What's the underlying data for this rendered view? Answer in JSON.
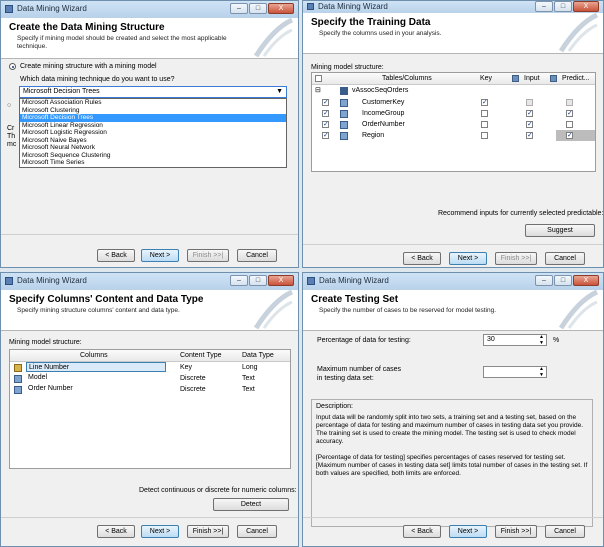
{
  "app_title": "Data Mining Wizard",
  "nav": {
    "back": "< Back",
    "next": "Next >",
    "finish": "Finish >>|",
    "cancel": "Cancel"
  },
  "win_controls": {
    "min": "–",
    "max": "□",
    "close": "X"
  },
  "w1": {
    "title": "Create the Data Mining Structure",
    "subtitle": "Specify if mining model should be created and select the most applicable technique.",
    "radio_label": "Create mining structure with a mining model",
    "question": "Which data mining technique do you want to use?",
    "selected": "Microsoft Decision Trees",
    "options": [
      "Microsoft Association Rules",
      "Microsoft Clustering",
      "Microsoft Decision Trees",
      "Microsoft Linear Regression",
      "Microsoft Logistic Regression",
      "Microsoft Naive Bayes",
      "Microsoft Neural Network",
      "Microsoft Sequence Clustering",
      "Microsoft Time Series"
    ],
    "left_glimpse": [
      "Cr",
      "Th",
      "mc"
    ]
  },
  "w2": {
    "title": "Specify the Training Data",
    "subtitle": "Specify the columns used in your analysis.",
    "structure_label": "Mining model structure:",
    "cols": {
      "tables": "Tables/Columns",
      "key": "Key",
      "input": "Input",
      "predict": "Predict..."
    },
    "table_name": "vAssocSeqOrders",
    "rows": [
      {
        "name": "CustomerKey",
        "key": true,
        "input": false,
        "predict": false
      },
      {
        "name": "IncomeGroup",
        "key": false,
        "input": true,
        "predict": true
      },
      {
        "name": "OrderNumber",
        "key": false,
        "input": true,
        "predict": false
      },
      {
        "name": "Region",
        "key": false,
        "input": true,
        "predict": true
      }
    ],
    "recommend": "Recommend inputs for currently selected predictable:",
    "suggest": "Suggest"
  },
  "w3": {
    "title": "Specify Columns' Content and Data Type",
    "subtitle": "Specify mining structure columns' content and data type.",
    "structure_label": "Mining model structure:",
    "cols": {
      "columns": "Columns",
      "content": "Content Type",
      "dtype": "Data Type"
    },
    "rows": [
      {
        "name": "Line Number",
        "content": "Key",
        "dtype": "Long"
      },
      {
        "name": "Model",
        "content": "Discrete",
        "dtype": "Text"
      },
      {
        "name": "Order Number",
        "content": "Discrete",
        "dtype": "Text"
      }
    ],
    "detect_label": "Detect continuous or discrete for numeric columns:",
    "detect": "Detect"
  },
  "w4": {
    "title": "Create Testing Set",
    "subtitle": "Specify the number of cases to be reserved for model testing.",
    "pct_label": "Percentage of data for testing:",
    "pct_value": "30",
    "pct_unit": "%",
    "max_label1": "Maximum number of cases",
    "max_label2": "in testing data set:",
    "max_value": "",
    "desc_label": "Description:",
    "desc_p1": "Input data will be randomly split into two sets, a training set and a testing set, based on the percentage of data for testing and maximum number of cases in testing data set you provide. The training set is used to create the mining model. The testing set is used to check model accuracy.",
    "desc_p2": "[Percentage of data for testing] specifies percentages of cases reserved for testing set. [Maximum number of cases in testing data set] limits total number of cases in the testing set. If both values are specified, both limits are enforced."
  }
}
